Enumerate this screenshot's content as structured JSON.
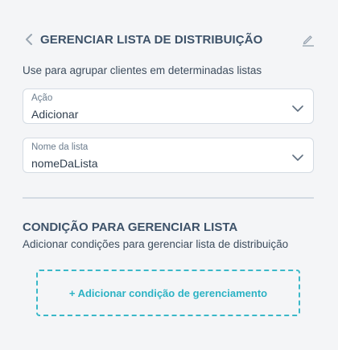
{
  "header": {
    "title": "GERENCIAR LISTA DE DISTRIBUIÇÃO",
    "back_icon": "chevron-left-icon",
    "edit_icon": "pencil-icon"
  },
  "subtitle": "Use para agrupar clientes em determinadas listas",
  "fields": {
    "action": {
      "label": "Ação",
      "value": "Adicionar"
    },
    "list_name": {
      "label": "Nome da lista",
      "value": "nomeDaLista"
    }
  },
  "condition_section": {
    "title": "CONDIÇÃO PARA GERENCIAR LISTA",
    "description": "Adicionar condições para gerenciar lista de distribuição",
    "add_button_label": "+ Adicionar condição de gerenciamento"
  },
  "colors": {
    "background": "#f4f5f7",
    "accent": "#2bb2c4",
    "title": "#3d5269"
  }
}
